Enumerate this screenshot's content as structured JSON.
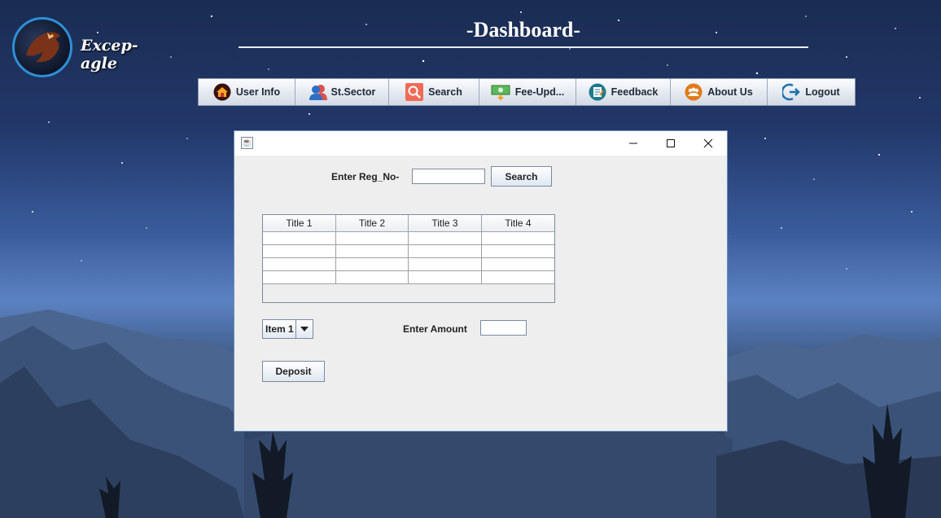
{
  "app": {
    "logo_text": "Excep-agle",
    "title": "-Dashboard-"
  },
  "nav": [
    {
      "label": "User Info",
      "icon": "home-icon"
    },
    {
      "label": "St.Sector",
      "icon": "users-icon"
    },
    {
      "label": "Search",
      "icon": "search-icon"
    },
    {
      "label": "Fee-Upd...",
      "icon": "money-icon"
    },
    {
      "label": "Feedback",
      "icon": "notepad-icon"
    },
    {
      "label": "About Us",
      "icon": "group-icon"
    },
    {
      "label": "Logout",
      "icon": "logout-icon"
    }
  ],
  "dialog": {
    "reg_label": "Enter Reg_No-",
    "reg_value": "",
    "search_button": "Search",
    "table": {
      "headers": [
        "Title 1",
        "Title 2",
        "Title 3",
        "Title 4"
      ],
      "rows": [
        [
          "",
          "",
          "",
          ""
        ],
        [
          "",
          "",
          "",
          ""
        ],
        [
          "",
          "",
          "",
          ""
        ],
        [
          "",
          "",
          "",
          ""
        ]
      ]
    },
    "combo_value": "Item 1",
    "amount_label": "Enter Amount",
    "amount_value": "",
    "deposit_button": "Deposit"
  },
  "colors": {
    "accent": "#2e8fd8",
    "dialog_bg": "#eeeeee"
  }
}
